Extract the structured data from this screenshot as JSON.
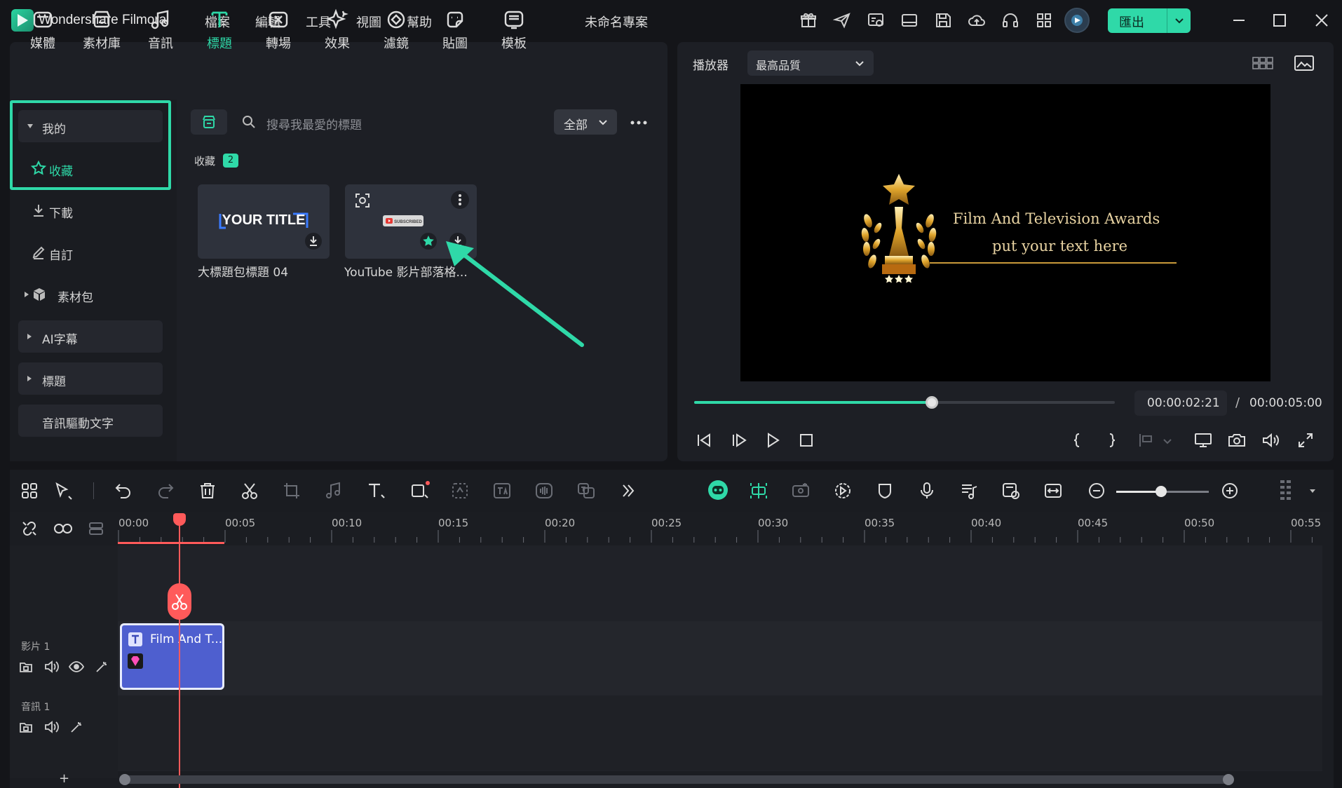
{
  "titlebar": {
    "app_name": "Wondershare Filmora",
    "menu": [
      "檔案",
      "編輯",
      "工具",
      "視圖",
      "幫助"
    ],
    "project_title": "未命名專案",
    "export_label": "匯出"
  },
  "categories": [
    "媒體",
    "素材庫",
    "音訊",
    "標題",
    "轉場",
    "效果",
    "濾鏡",
    "貼圖",
    "模板"
  ],
  "active_category": "標題",
  "sidebar": {
    "mine": "我的",
    "favorites": "收藏",
    "downloads": "下載",
    "custom": "自訂",
    "packs": "素材包",
    "ai_captions": "AI字幕",
    "titles": "標題",
    "audio_to_text": "音訊驅動文字"
  },
  "browser": {
    "search_placeholder": "搜尋我最愛的標題",
    "filter_label": "全部",
    "section_label": "收藏",
    "section_count": "2",
    "items": [
      {
        "label": "大標題包標題 04",
        "thumb_text": "YOUR TITLE"
      },
      {
        "label": "YouTube 影片部落格...",
        "thumb_text": "SUBSCRIBED"
      }
    ]
  },
  "player": {
    "label": "播放器",
    "quality": "最高品質",
    "video_line1": "Film And Television Awards",
    "video_line2": "put your text here",
    "current_time": "00:00:02:21",
    "separator": "/",
    "total_time": "00:00:05:00",
    "progress": 0.567
  },
  "timeline": {
    "ruler": [
      "00:00",
      "00:05",
      "00:10",
      "00:15",
      "00:20",
      "00:25",
      "00:30",
      "00:35",
      "00:40",
      "00:45",
      "00:50",
      "00:55"
    ],
    "video_track": "影片 1",
    "audio_track": "音訊 1",
    "clip_title": "Film And T...",
    "add_track": "+"
  },
  "colors": {
    "accent": "#2fd9a8",
    "playhead": "#ff5a5a",
    "clip": "#4e5fcf"
  }
}
